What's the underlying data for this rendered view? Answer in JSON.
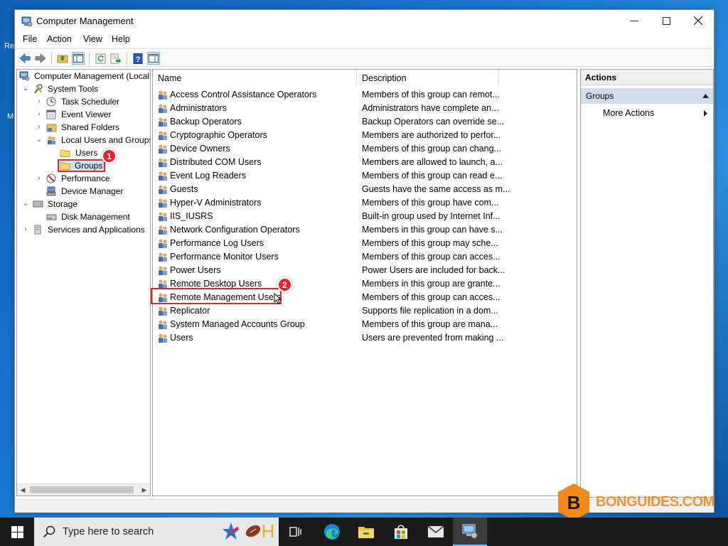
{
  "window": {
    "title": "Computer Management",
    "menu": [
      "File",
      "Action",
      "View",
      "Help"
    ]
  },
  "tree": {
    "root": "Computer Management (Local",
    "items": [
      {
        "label": "System Tools"
      },
      {
        "label": "Task Scheduler"
      },
      {
        "label": "Event Viewer"
      },
      {
        "label": "Shared Folders"
      },
      {
        "label": "Local Users and Groups"
      },
      {
        "label": "Users"
      },
      {
        "label": "Groups"
      },
      {
        "label": "Performance"
      },
      {
        "label": "Device Manager"
      },
      {
        "label": "Storage"
      },
      {
        "label": "Disk Management"
      },
      {
        "label": "Services and Applications"
      }
    ]
  },
  "list": {
    "columns": [
      "Name",
      "Description"
    ],
    "rows": [
      {
        "name": "Access Control Assistance Operators",
        "desc": "Members of this group can remot..."
      },
      {
        "name": "Administrators",
        "desc": "Administrators have complete an..."
      },
      {
        "name": "Backup Operators",
        "desc": "Backup Operators can override se..."
      },
      {
        "name": "Cryptographic Operators",
        "desc": "Members are authorized to perfor..."
      },
      {
        "name": "Device Owners",
        "desc": "Members of this group can chang..."
      },
      {
        "name": "Distributed COM Users",
        "desc": "Members are allowed to launch, a..."
      },
      {
        "name": "Event Log Readers",
        "desc": "Members of this group can read e..."
      },
      {
        "name": "Guests",
        "desc": "Guests have the same access as m..."
      },
      {
        "name": "Hyper-V Administrators",
        "desc": "Members of this group have com..."
      },
      {
        "name": "IIS_IUSRS",
        "desc": "Built-in group used by Internet Inf..."
      },
      {
        "name": "Network Configuration Operators",
        "desc": "Members in this group can have s..."
      },
      {
        "name": "Performance Log Users",
        "desc": "Members of this group may sche..."
      },
      {
        "name": "Performance Monitor Users",
        "desc": "Members of this group can acces..."
      },
      {
        "name": "Power Users",
        "desc": "Power Users are included for back..."
      },
      {
        "name": "Remote Desktop Users",
        "desc": "Members in this group are grante..."
      },
      {
        "name": "Remote Management Users",
        "desc": "Members of this group can acces..."
      },
      {
        "name": "Replicator",
        "desc": "Supports file replication in a dom..."
      },
      {
        "name": "System Managed Accounts Group",
        "desc": "Members of this group are mana..."
      },
      {
        "name": "Users",
        "desc": "Users are prevented from making ..."
      }
    ]
  },
  "actions": {
    "header": "Actions",
    "section": "Groups",
    "items": [
      "More Actions"
    ]
  },
  "annotations": {
    "step1": "1",
    "step2": "2",
    "color": "#e3262b"
  },
  "watermark": "BONGUIDES.COM",
  "taskbar": {
    "search_placeholder": "Type here to search",
    "icons": [
      "windows-start-icon",
      "search-icon",
      "task-view-icon",
      "edge-icon",
      "file-explorer-icon",
      "store-icon",
      "mail-icon",
      "computer-management-icon"
    ]
  },
  "desktop": {
    "fragments": [
      "Re",
      "M"
    ]
  }
}
